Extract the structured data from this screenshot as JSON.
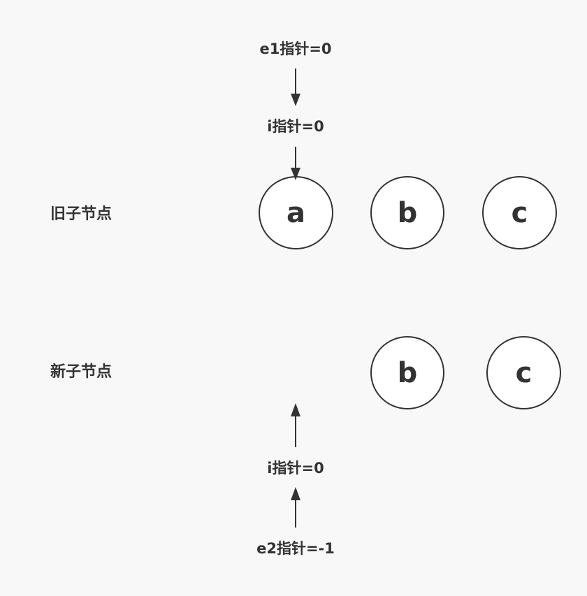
{
  "row_labels": {
    "old": "旧子节点",
    "new": "新子节点"
  },
  "old_nodes": [
    "a",
    "b",
    "c"
  ],
  "new_nodes": [
    "b",
    "c"
  ],
  "pointers": {
    "e1": "e1指针=0",
    "i_old": "i指针=0",
    "i_new": "i指针=0",
    "e2": "e2指针=-1"
  }
}
